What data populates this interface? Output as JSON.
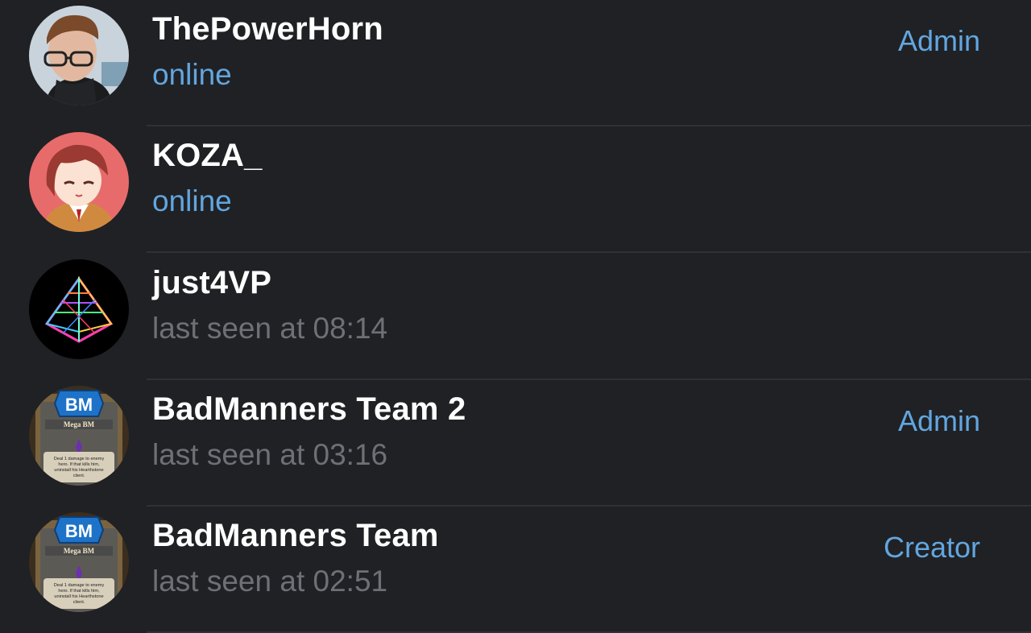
{
  "members": [
    {
      "name": "ThePowerHorn",
      "status": "online",
      "online": true,
      "role": "Admin",
      "avatar_icon": "user-photo-glasses"
    },
    {
      "name": "KOZA_",
      "status": "online",
      "online": true,
      "role": "",
      "avatar_icon": "anime-girl-avatar"
    },
    {
      "name": "just4VP",
      "status": "last seen at 08:14",
      "online": false,
      "role": "",
      "avatar_icon": "neon-pyramid-avatar"
    },
    {
      "name": "BadManners Team 2",
      "status": "last seen at 03:16",
      "online": false,
      "role": "Admin",
      "avatar_icon": "hearthstone-card-avatar"
    },
    {
      "name": "BadManners Team",
      "status": "last seen at 02:51",
      "online": false,
      "role": "Creator",
      "avatar_icon": "hearthstone-card-avatar"
    }
  ],
  "avatar_card": {
    "badge": "BM",
    "card_title": "Mega BM",
    "card_text_line1": "Deal 1 damage to enemy",
    "card_text_line2": "hero. If that kills him,",
    "card_text_line3": "uninstall his Hearthstone",
    "card_text_line4": "client."
  },
  "colors": {
    "background": "#202124",
    "accent": "#62a6e0",
    "muted": "#6d7176",
    "text": "#ffffff"
  }
}
